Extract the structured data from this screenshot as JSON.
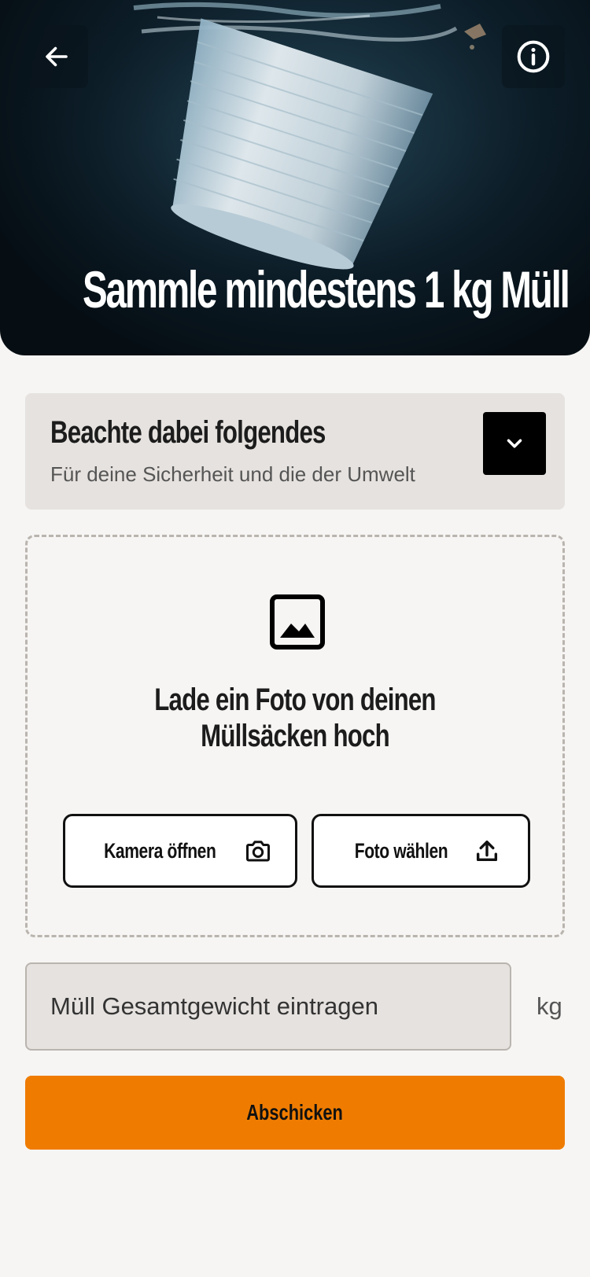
{
  "header": {
    "title": "Sammle mindestens 1 kg Müll",
    "back_icon": "arrow-left-icon",
    "info_icon": "info-icon"
  },
  "notice": {
    "title": "Beachte dabei folgendes",
    "subtitle": "Für deine Sicherheit und die der Umwelt",
    "toggle_icon": "chevron-down-icon"
  },
  "upload": {
    "icon": "image-icon",
    "title_line1": "Lade ein Foto von deinen",
    "title_line2": "Müllsäcken hoch",
    "camera_label": "Kamera öffnen",
    "camera_icon": "camera-icon",
    "choose_label": "Foto wählen",
    "choose_icon": "upload-icon"
  },
  "weight": {
    "placeholder": "Müll Gesamtgewicht eintragen",
    "unit": "kg"
  },
  "submit": {
    "label": "Abschicken"
  },
  "colors": {
    "accent": "#ef7c00",
    "card_bg": "#e6e2df",
    "page_bg": "#f6f5f3"
  }
}
